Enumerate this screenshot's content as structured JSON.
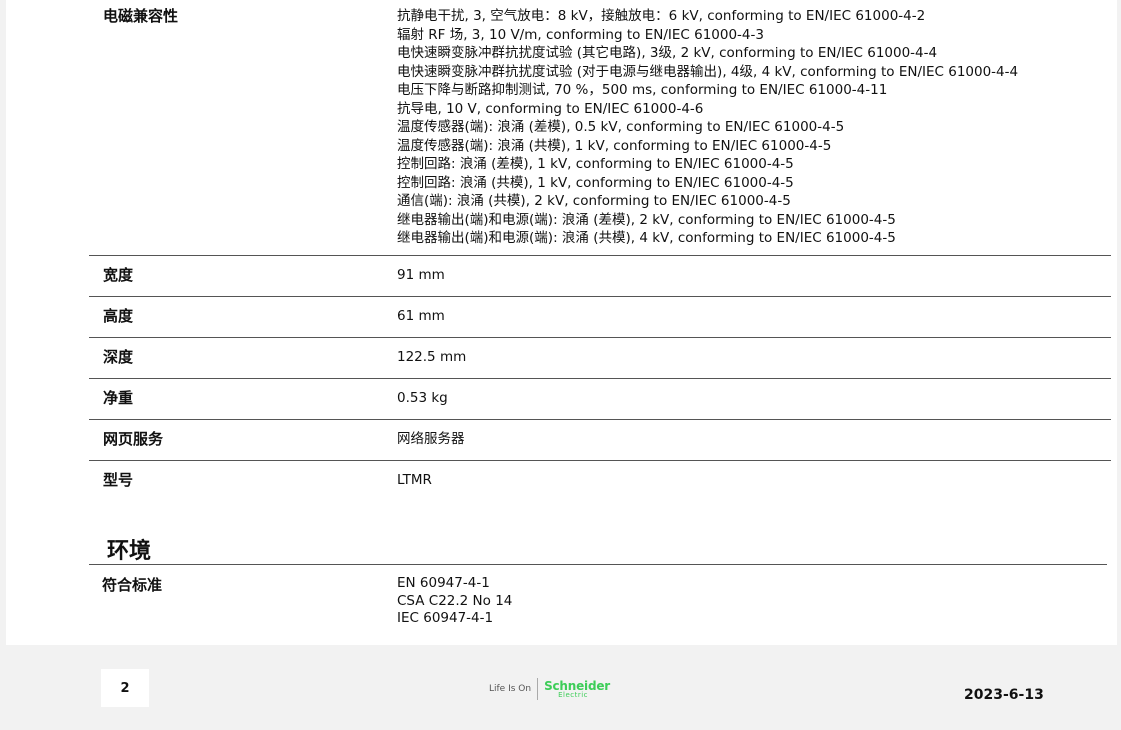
{
  "specs": [
    {
      "label": "电磁兼容性",
      "lines": [
        "抗静电干扰, 3, 空气放电：8 kV，接触放电：6 kV, conforming to EN/IEC 61000-4-2",
        "辐射 RF 场, 3, 10 V/m, conforming to EN/IEC 61000-4-3",
        "电快速瞬变脉冲群抗扰度试验 (其它电路), 3级, 2 kV, conforming to EN/IEC 61000-4-4",
        "电快速瞬变脉冲群抗扰度试验 (对于电源与继电器输出), 4级, 4 kV, conforming to EN/IEC 61000-4-4",
        "电压下降与断路抑制测试, 70 %，500 ms, conforming to EN/IEC 61000-4-11",
        "抗导电, 10 V, conforming to EN/IEC 61000-4-6",
        "温度传感器(端): 浪涌 (差模), 0.5 kV, conforming to EN/IEC 61000-4-5",
        "温度传感器(端): 浪涌 (共模), 1 kV, conforming to EN/IEC 61000-4-5",
        "控制回路: 浪涌 (差模), 1 kV, conforming to EN/IEC 61000-4-5",
        "控制回路: 浪涌 (共模), 1 kV, conforming to EN/IEC 61000-4-5",
        "通信(端): 浪涌 (共模), 2 kV, conforming to EN/IEC 61000-4-5",
        "继电器输出(端)和电源(端): 浪涌 (差模), 2 kV, conforming to EN/IEC 61000-4-5",
        "继电器输出(端)和电源(端): 浪涌 (共模), 4 kV, conforming to EN/IEC 61000-4-5"
      ]
    },
    {
      "label": "宽度",
      "value": "91 mm"
    },
    {
      "label": "高度",
      "value": "61 mm"
    },
    {
      "label": "深度",
      "value": "122.5 mm"
    },
    {
      "label": "净重",
      "value": "0.53 kg"
    },
    {
      "label": "网页服务",
      "value": "网络服务器"
    },
    {
      "label": "型号",
      "value": "LTMR"
    }
  ],
  "environment": {
    "title": "环境",
    "label": "符合标准",
    "lines": [
      "EN 60947-4-1",
      "CSA C22.2 No 14",
      "IEC 60947-4-1"
    ]
  },
  "footer": {
    "page_number": "2",
    "tagline": "Life Is On",
    "brand_name": "Schneider",
    "brand_sub": "Electric",
    "date": "2023-6-13",
    "brand_color": "#3dcd58"
  }
}
